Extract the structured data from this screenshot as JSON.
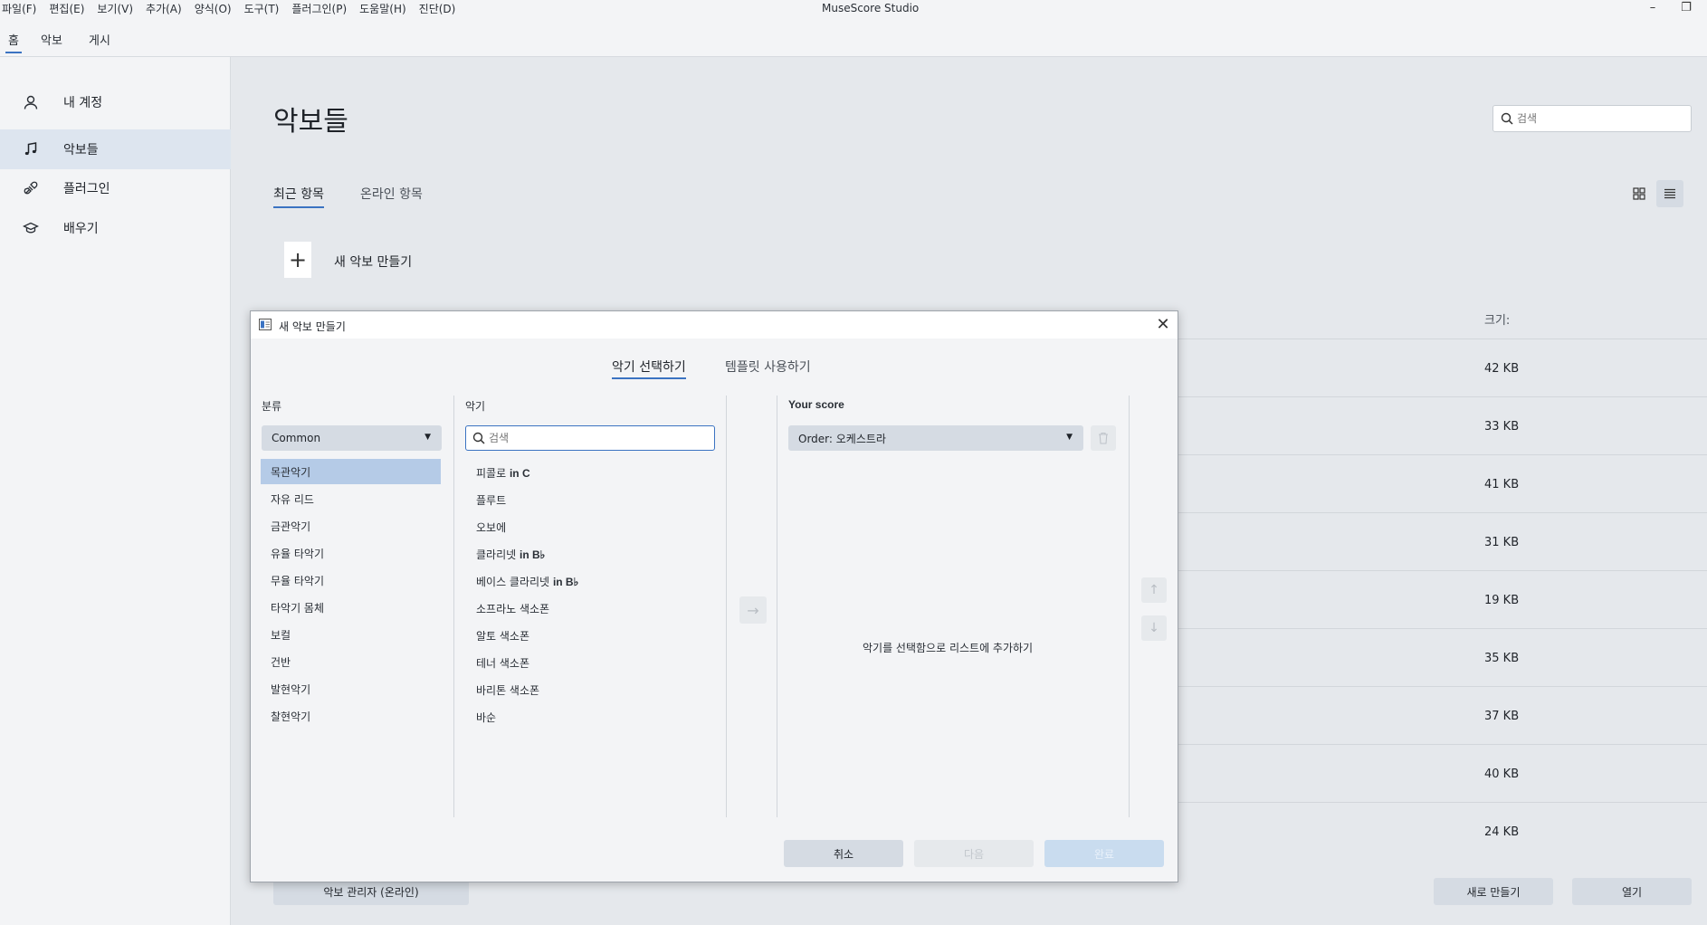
{
  "titlebar": {
    "menu": [
      "파일(F)",
      "편집(E)",
      "보기(V)",
      "추가(A)",
      "양식(O)",
      "도구(T)",
      "플러그인(P)",
      "도움말(H)",
      "진단(D)"
    ],
    "app_title": "MuseScore Studio",
    "minimize_glyph": "–",
    "restore_glyph": "❐"
  },
  "top_tabs": [
    "홈",
    "악보",
    "게시"
  ],
  "sidebar": {
    "items": [
      {
        "label": "내 계정",
        "icon": "account-icon"
      },
      {
        "label": "악보들",
        "icon": "music-note-icon"
      },
      {
        "label": "플러그인",
        "icon": "plugin-icon"
      },
      {
        "label": "배우기",
        "icon": "learn-icon"
      }
    ]
  },
  "main": {
    "title": "악보들",
    "search_placeholder": "검색",
    "tabs": [
      "최근 항목",
      "온라인 항목"
    ],
    "new_score_plus": "+",
    "new_score_label": "새 악보 만들기",
    "size_header": "크기:",
    "sizes": [
      "42 KB",
      "33 KB",
      "41 KB",
      "31 KB",
      "19 KB",
      "35 KB",
      "37 KB",
      "40 KB",
      "24 KB"
    ],
    "score_manager_button": "악보 관리자 (온라인)",
    "new_button": "새로 만들기",
    "open_button": "열기"
  },
  "dialog": {
    "title": "새 악보 만들기",
    "close_glyph": "✕",
    "tabs": [
      "악기 선택하기",
      "템플릿 사용하기"
    ],
    "category_header": "분류",
    "category_dropdown": "Common",
    "categories": [
      "목관악기",
      "자유 리드",
      "금관악기",
      "유율 타악기",
      "무율 타악기",
      "타악기 몸체",
      "보컬",
      "건반",
      "발현악기",
      "찰현악기"
    ],
    "instruments_header": "악기",
    "instrument_search_placeholder": "검색",
    "instruments": [
      {
        "name": "피콜로",
        "suffix": "in C"
      },
      {
        "name": "플루트",
        "suffix": ""
      },
      {
        "name": "오보에",
        "suffix": ""
      },
      {
        "name": "클라리넷",
        "suffix": "in B♭"
      },
      {
        "name": "베이스 클라리넷",
        "suffix": "in B♭"
      },
      {
        "name": "소프라노 색소폰",
        "suffix": ""
      },
      {
        "name": "알토 색소폰",
        "suffix": ""
      },
      {
        "name": "테너 색소폰",
        "suffix": ""
      },
      {
        "name": "바리톤 색소폰",
        "suffix": ""
      },
      {
        "name": "바순",
        "suffix": ""
      }
    ],
    "add_arrow": "→",
    "your_score_header": "Your score",
    "order_dropdown": "Order: 오케스트라",
    "empty_hint": "악기를 선택함으로 리스트에 추가하기",
    "move_up": "↑",
    "move_down": "↓",
    "buttons": {
      "cancel": "취소",
      "next": "다음",
      "done": "완료"
    },
    "dropdown_caret": "▼"
  },
  "colors": {
    "accent": "#3b73c2",
    "selection": "#b5cbe7",
    "sidebar_active": "#dde5ef"
  }
}
